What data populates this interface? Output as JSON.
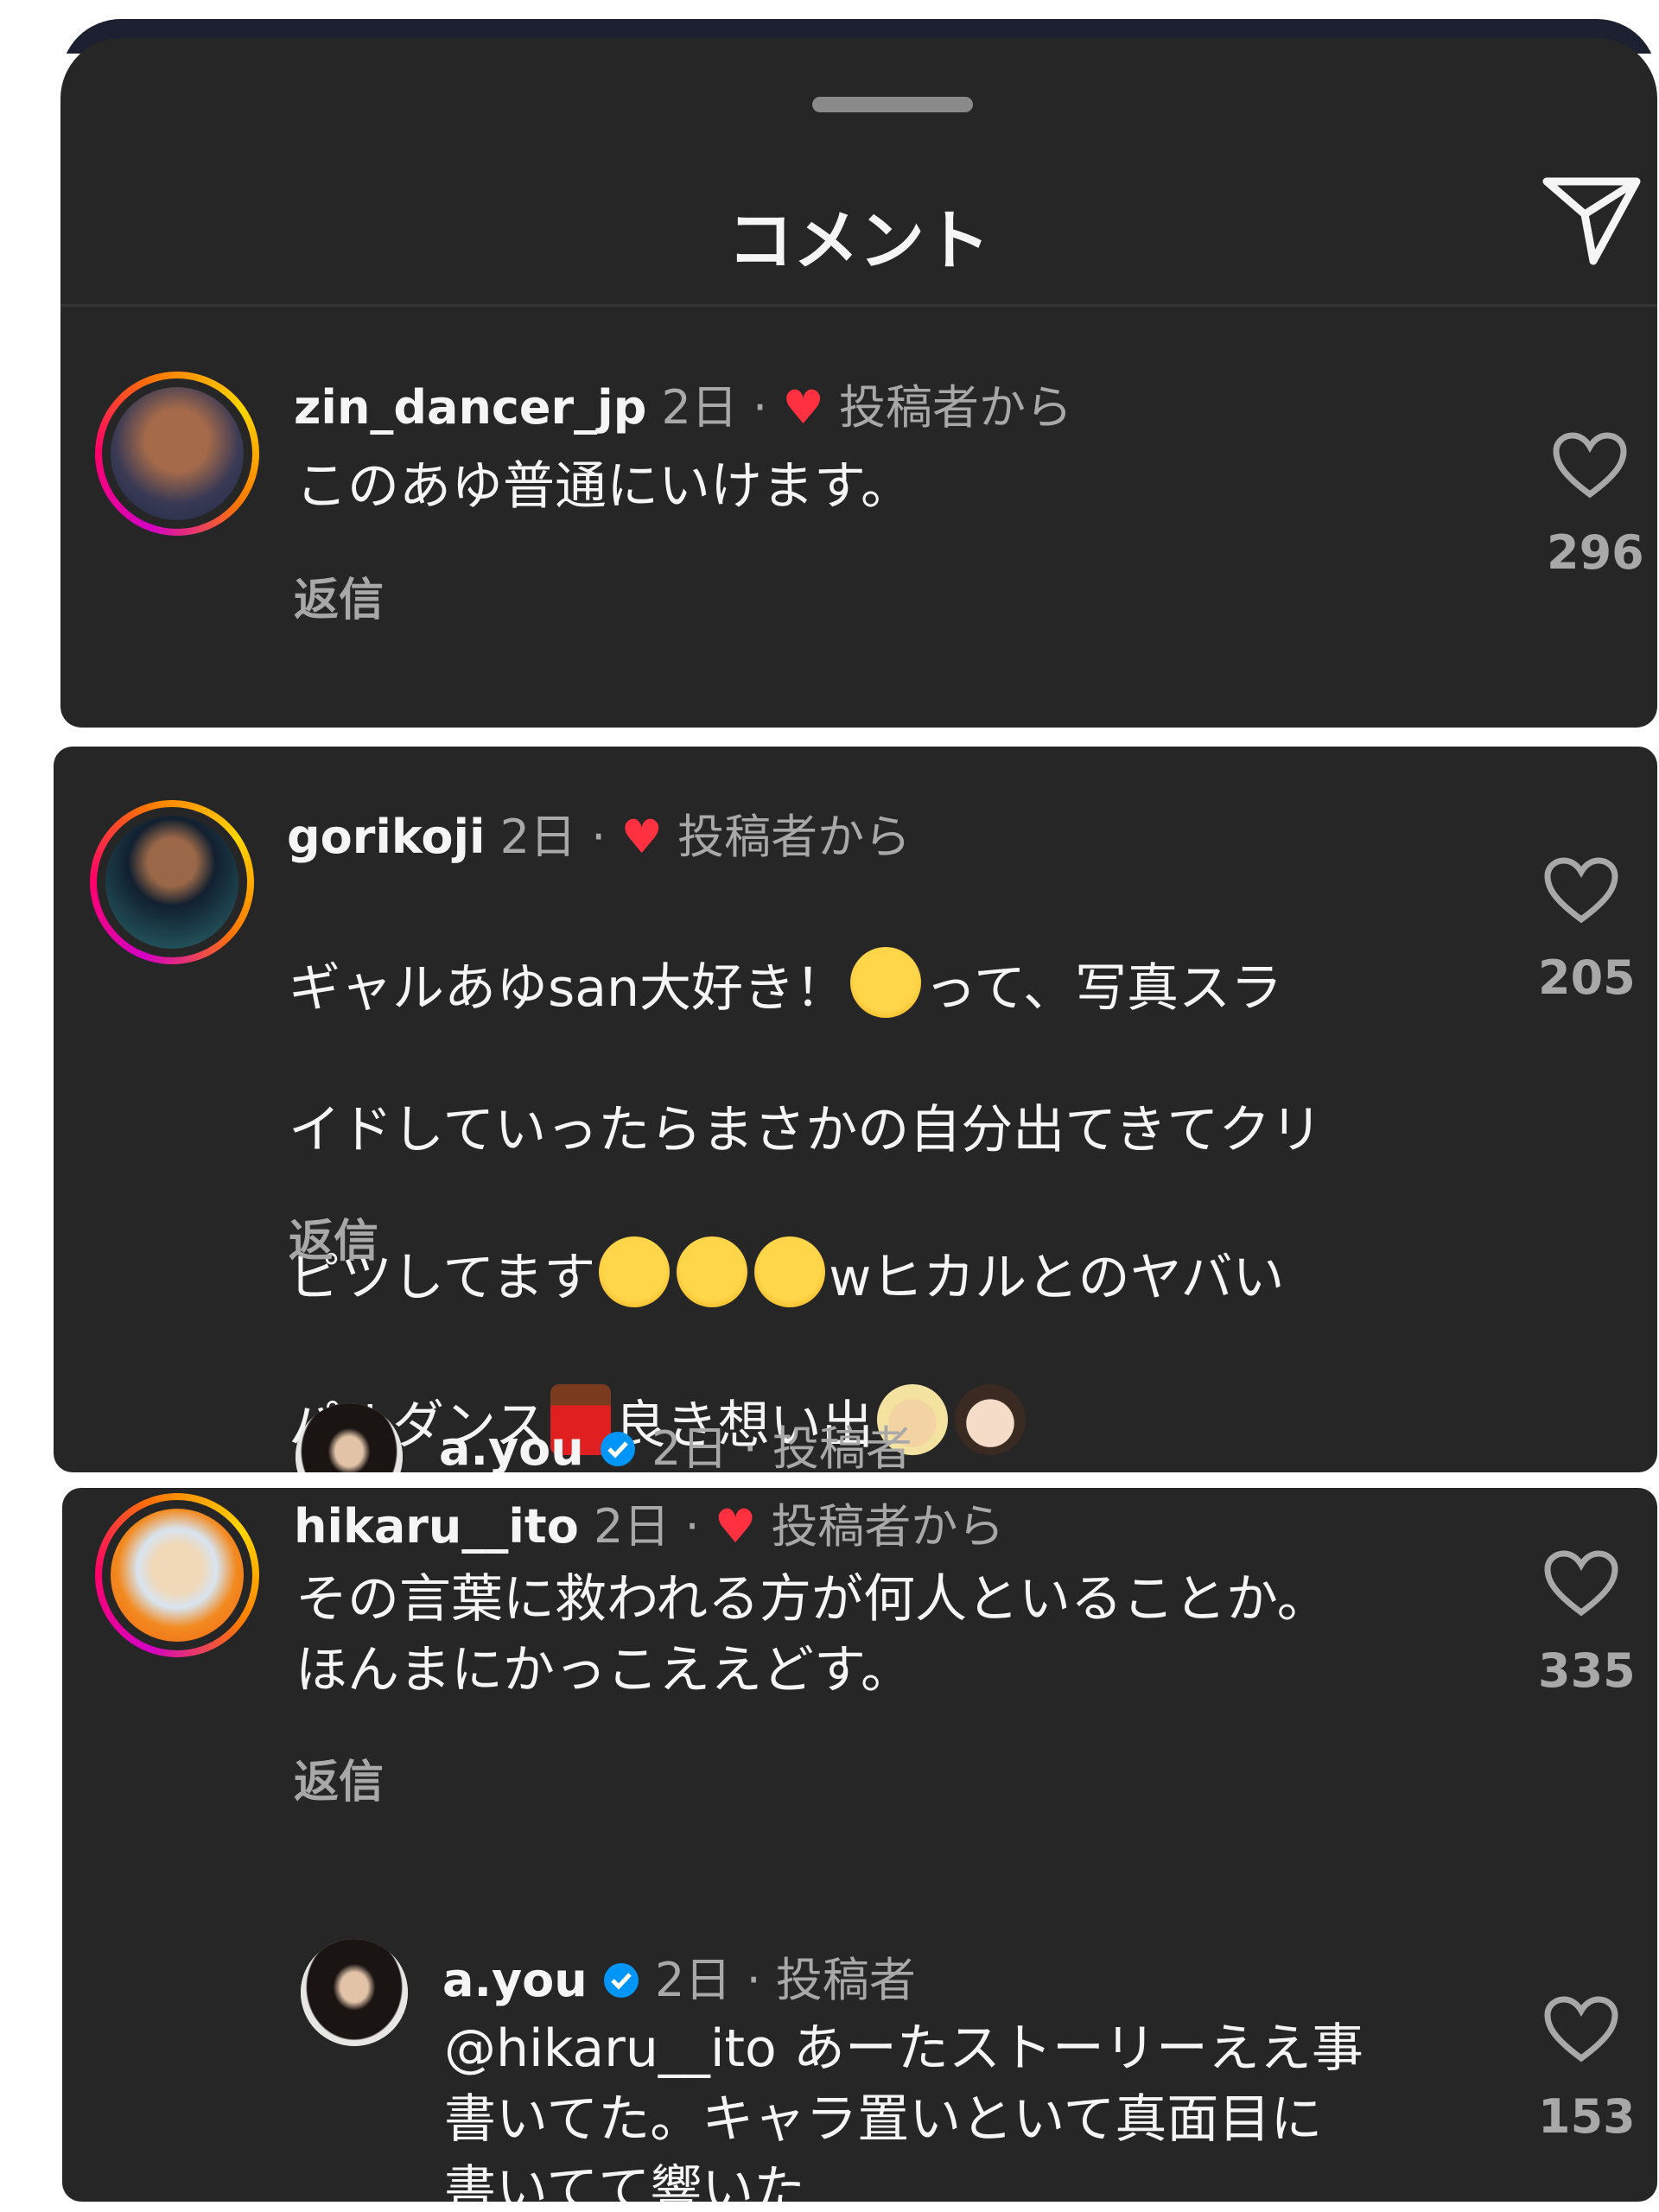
{
  "sheet": {
    "title": "コメント"
  },
  "comments": [
    {
      "username": "zin_dancer_jp",
      "time": "2日",
      "dot": " · ",
      "author_label": "投稿者から",
      "text": "このあゆ普通にいけます。",
      "reply_label": "返信",
      "likes": "296"
    },
    {
      "username": "gorikoji",
      "time": "2日",
      "dot": " · ",
      "author_label": "投稿者から",
      "text_parts": [
        "ギャルあゆsan大好き！",
        "って、写真スラ",
        "イドしていったらまさかの自分出てきてクリ",
        "ピツしてます",
        "wヒカルとのヤバい",
        "パルダンス",
        "良き想い出"
      ],
      "reply_label": "返信",
      "likes": "205",
      "reply": {
        "username": "a.you",
        "time": "2日",
        "dot": " · ",
        "author_label": "投稿者"
      }
    },
    {
      "username": "hikaru__ito",
      "time": "2日",
      "dot": " · ",
      "author_label": "投稿者から",
      "text": "その言葉に救われる方が何人といることか。\nほんまにかっこええどす。",
      "reply_label": "返信",
      "likes": "335",
      "reply": {
        "username": "a.you",
        "time": "2日",
        "dot": " · ",
        "author_label": "投稿者",
        "text": "@hikaru__ito あーたストーリーええ事\n書いてた。キャラ置いといて真面目に\n書いてて響いた",
        "likes": "153"
      }
    }
  ],
  "icons": {
    "send": "send-icon",
    "like": "heart-outline-icon",
    "liked_by_author": "heart-filled-icon",
    "verified": "verified-badge-icon"
  },
  "colors": {
    "background": "#262626",
    "heart": "#ff3040",
    "verified": "#0095f6",
    "secondary_text": "#a8a8a8"
  }
}
